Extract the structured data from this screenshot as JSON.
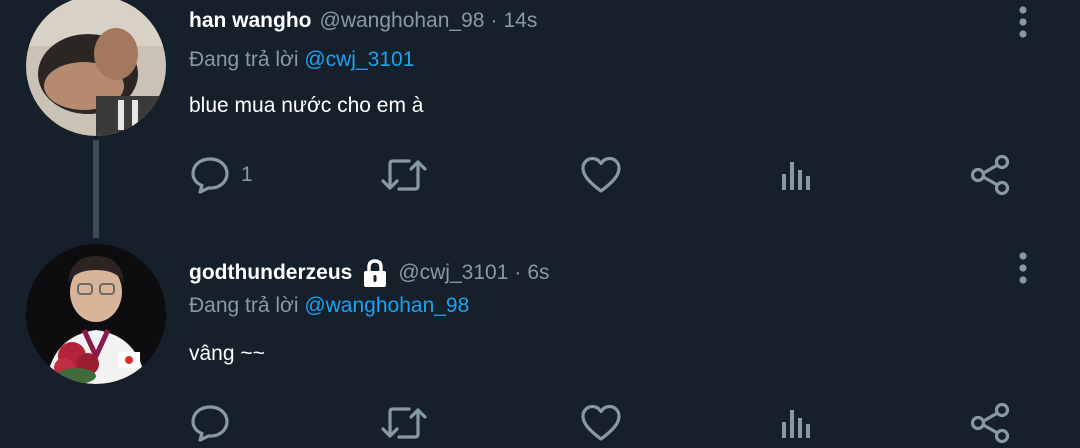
{
  "colors": {
    "background": "#15202b",
    "name": "#ffffff",
    "secondary_text": "#8899a6",
    "mention": "#1da1f2",
    "icon": "#8899a6",
    "thread_line": "#3d4a57"
  },
  "tweets": [
    {
      "display_name": "han wangho",
      "handle": "@wanghohan_98",
      "separator": "·",
      "time": "14s",
      "reply_prefix": "Đang trả lời",
      "reply_to": "@cwj_3101",
      "text": "blue mua nước cho em à",
      "reply_count": "1",
      "icons": [
        "reply-icon",
        "retweet-icon",
        "like-icon",
        "stats-icon",
        "share-icon",
        "more-icon"
      ]
    },
    {
      "display_name": "godthunderzeus",
      "protected_icon": "lock-icon",
      "handle": "@cwj_3101",
      "separator": "·",
      "time": "6s",
      "reply_prefix": "Đang trả lời",
      "reply_to": "@wanghohan_98",
      "text": "vâng ~~",
      "reply_count": "",
      "icons": [
        "reply-icon",
        "retweet-icon",
        "like-icon",
        "stats-icon",
        "share-icon",
        "more-icon"
      ]
    }
  ]
}
